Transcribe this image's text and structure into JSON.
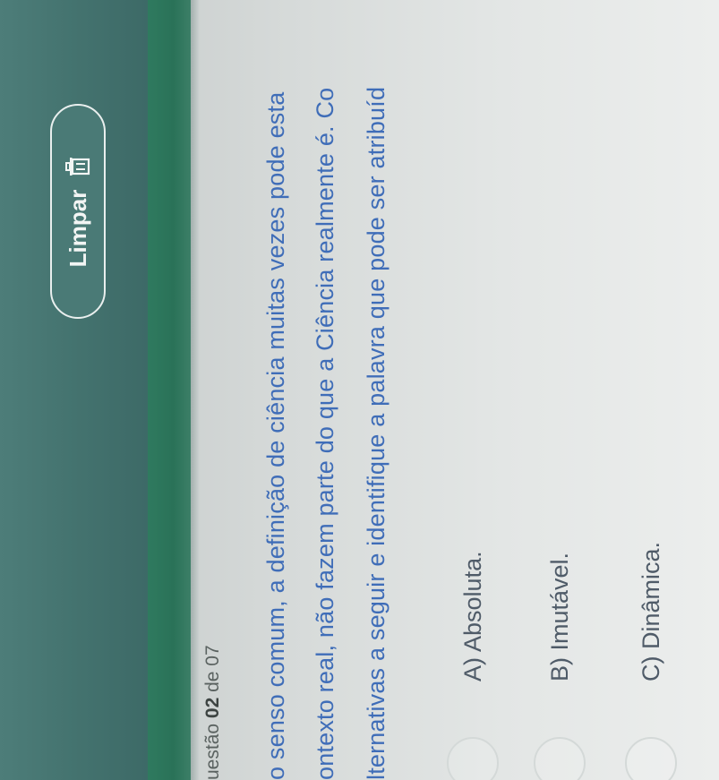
{
  "header": {
    "clear_button_label": "Limpar",
    "clear_icon": "trash-icon",
    "bar_color": "#44736f",
    "accent_color": "#2f7a5f"
  },
  "question": {
    "counter_prefix": "uestão",
    "counter_current": "02",
    "counter_separator": "de",
    "counter_total": "07",
    "lines": [
      "o senso comum, a definição de ciência muitas vezes pode esta",
      "ontexto real, não fazem parte do que a Ciência realmente é. Co",
      "lternativas a seguir e identifique a palavra que pode ser atribuíd"
    ],
    "text_color": "#3f6db8"
  },
  "options": [
    {
      "label": "A) Absoluta."
    },
    {
      "label": "B) Imutável."
    },
    {
      "label": "C) Dinâmica."
    }
  ]
}
